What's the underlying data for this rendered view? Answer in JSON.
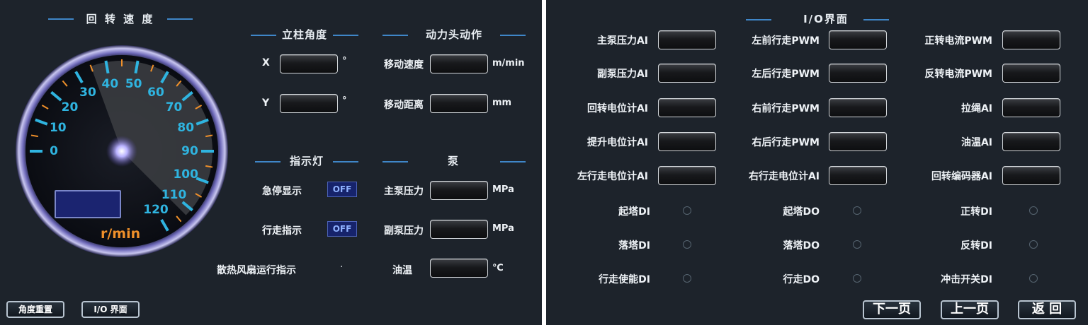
{
  "left": {
    "gauge": {
      "title": "回 转 速 度",
      "unit": "r/min",
      "scale_labels": [
        "0",
        "10",
        "20",
        "30",
        "40",
        "50",
        "60",
        "70",
        "80",
        "90",
        "100",
        "110",
        "120"
      ],
      "colors": {
        "scale": "#2fb4e0",
        "unit": "#f0902a",
        "minor_tick": "#f0902a"
      }
    },
    "column_angle": {
      "title": "立柱角度",
      "rows": [
        {
          "label": "X",
          "unit": "°"
        },
        {
          "label": "Y",
          "unit": "°"
        }
      ]
    },
    "power_head": {
      "title": "动力头动作",
      "rows": [
        {
          "label": "移动速度",
          "unit": "m/min"
        },
        {
          "label": "移动距离",
          "unit": "mm"
        }
      ]
    },
    "indicators": {
      "title": "指示灯",
      "rows": [
        {
          "label": "急停显示",
          "state": "OFF"
        },
        {
          "label": "行走指示",
          "state": "OFF"
        },
        {
          "label": "散热风扇运行指示",
          "state": "·"
        }
      ]
    },
    "pump": {
      "title": "泵",
      "rows": [
        {
          "label": "主泵压力",
          "unit": "MPa"
        },
        {
          "label": "副泵压力",
          "unit": "MPa"
        },
        {
          "label": "油温",
          "unit": "℃"
        }
      ]
    },
    "buttons": {
      "reset": "角度重置",
      "io": "I/O 界面"
    }
  },
  "right": {
    "title": "I/O界面",
    "col1": [
      "主泵压力AI",
      "副泵压力AI",
      "回转电位计AI",
      "提升电位计AI",
      "左行走电位计AI"
    ],
    "col2": [
      "左前行走PWM",
      "左后行走PWM",
      "右前行走PWM",
      "右后行走PWM",
      "右行走电位计AI"
    ],
    "col3": [
      "正转电流PWM",
      "反转电流PWM",
      "拉绳AI",
      "油温AI",
      "回转编码器AI"
    ],
    "digital1": [
      "起塔DI",
      "落塔DI",
      "行走使能DI"
    ],
    "digital2": [
      "起塔DO",
      "落塔DO",
      "行走DO"
    ],
    "digital3": [
      "正转DI",
      "反转DI",
      "冲击开关DI"
    ],
    "buttons": {
      "next": "下一页",
      "prev": "上一页",
      "back": "返 回"
    }
  },
  "colors": {
    "panel_bg": "#1d232b",
    "accent_line": "#3f86c8",
    "text": "#eef2f6",
    "off_bg": "#16236b"
  }
}
